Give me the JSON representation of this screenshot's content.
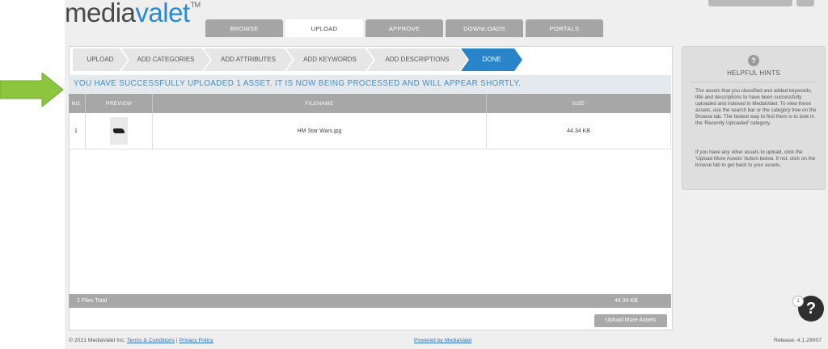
{
  "header": {
    "logo_part1": "media",
    "logo_part2": "valet",
    "logo_tm": "TM",
    "tabs": [
      {
        "label": "BROWSE",
        "active": false
      },
      {
        "label": "UPLOAD",
        "active": true
      },
      {
        "label": "APPROVE",
        "active": false
      },
      {
        "label": "DOWNLOADS",
        "active": false
      },
      {
        "label": "PORTALS",
        "active": false
      }
    ]
  },
  "steps": [
    {
      "label": "UPLOAD"
    },
    {
      "label": "ADD CATEGORIES"
    },
    {
      "label": "ADD ATTRIBUTES"
    },
    {
      "label": "ADD KEYWORDS"
    },
    {
      "label": "ADD DESCRIPTIONS"
    },
    {
      "label": "DONE"
    }
  ],
  "success_message": "YOU HAVE SUCCESSFULLY UPLOADED 1 ASSET. IT IS NOW BEING PROCESSED AND WILL APPEAR SHORTLY.",
  "table": {
    "columns": [
      "NO.",
      "PREVIEW",
      "FILENAME",
      "SIZE"
    ],
    "rows": [
      {
        "no": "1",
        "filename": "HM Star Wars.jpg",
        "size": "44.34 KB"
      }
    ]
  },
  "summary": {
    "total_label": "1 Files Total",
    "total_size": "44.34 KB"
  },
  "upload_more_label": "Upload More Assets",
  "hints": {
    "title": "HELPFUL HINTS",
    "icon": "?",
    "paragraph1": "The assets that you classified and added keywords, title and descriptions to have been successfully uploaded and indexed in MediaValet. To view these assets, use the search bar or the category tree on the Browse tab. The fastest way to find them is to look in the 'Recently Uploaded' category.",
    "paragraph2": "If you have any other assets to upload, click the 'Upload More Assets' button below. If not, click on the browse tab to get back to your assets."
  },
  "help": {
    "icon": "?",
    "badge": "1"
  },
  "footer": {
    "copyright": "© 2021 MediaValet Inc.",
    "terms": "Terms & Conditions",
    "separator": "|",
    "privacy": "Privacy Policy",
    "powered": "Powered by MediaValet",
    "release": "Release: 4.1.29007"
  },
  "colors": {
    "accent": "#2a84c9",
    "arrow": "#8cc63f",
    "grey_header": "#a7a7a7"
  }
}
